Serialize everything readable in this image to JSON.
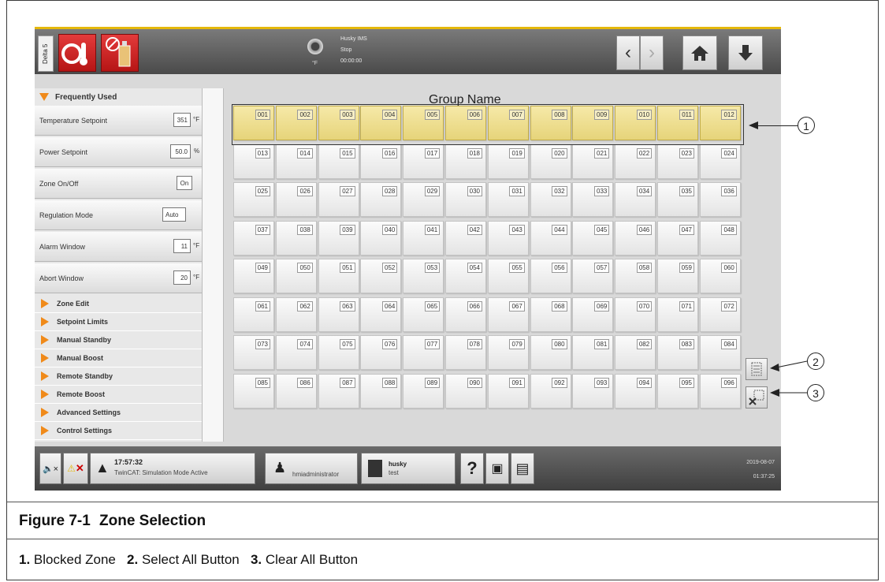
{
  "topbar": {
    "device_tab": "Delta 5",
    "ims_title": "Husky IMS",
    "ims_status": "Stop",
    "ims_time": "00:00:00",
    "ims_unit": "°F"
  },
  "sidebar": {
    "header": "Frequently Used",
    "rows": [
      {
        "label": "Temperature Setpoint",
        "value": "351",
        "unit": "°F"
      },
      {
        "label": "Power Setpoint",
        "value": "50.0",
        "unit": "%"
      },
      {
        "label": "Zone On/Off",
        "value": "On",
        "unit": ""
      },
      {
        "label": "Regulation Mode",
        "value": "Auto",
        "unit": ""
      },
      {
        "label": "Alarm Window",
        "value": "11",
        "unit": "°F"
      },
      {
        "label": "Abort Window",
        "value": "20",
        "unit": "°F"
      }
    ],
    "sections": [
      "Zone Edit",
      "Setpoint Limits",
      "Manual Standby",
      "Manual Boost",
      "Remote Standby",
      "Remote Boost",
      "Advanced Settings",
      "Control Settings"
    ]
  },
  "main": {
    "title": "Group Name",
    "zones_blocked_count": 12
  },
  "statusbar": {
    "alarm_time": "17:57:32",
    "alarm_text": "TwinCAT: Simulation Mode Active",
    "user": "hmiadministrator",
    "mold_name": "husky",
    "mold_sub": "test",
    "date": "2019-08-07",
    "time": "01:37:25"
  },
  "callouts": [
    "1",
    "2",
    "3"
  ],
  "caption": {
    "figure_num": "Figure 7-1",
    "figure_title": "Zone Selection",
    "legend": [
      {
        "num": "1.",
        "text": "Blocked Zone"
      },
      {
        "num": "2.",
        "text": "Select All Button"
      },
      {
        "num": "3.",
        "text": "Clear All Button"
      }
    ]
  }
}
